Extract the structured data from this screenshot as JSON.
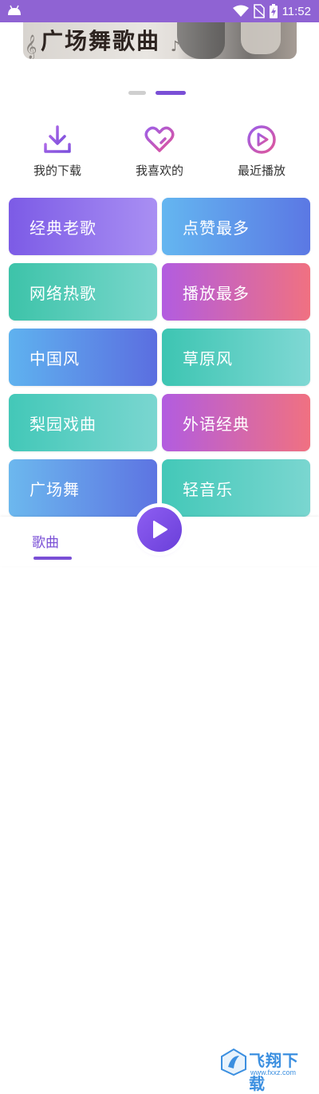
{
  "status_bar": {
    "time": "11:52"
  },
  "banner": {
    "title": "广场舞歌曲"
  },
  "pager": {
    "count": 2,
    "active_index": 1
  },
  "quick_actions": [
    {
      "label": "我的下载",
      "icon": "download-icon"
    },
    {
      "label": "我喜欢的",
      "icon": "heart-icon"
    },
    {
      "label": "最近播放",
      "icon": "play-circle-icon"
    }
  ],
  "categories": [
    {
      "label": "经典老歌"
    },
    {
      "label": "点赞最多"
    },
    {
      "label": "网络热歌"
    },
    {
      "label": "播放最多"
    },
    {
      "label": "中国风"
    },
    {
      "label": "草原风"
    },
    {
      "label": "梨园戏曲"
    },
    {
      "label": "外语经典"
    },
    {
      "label": "广场舞"
    },
    {
      "label": "轻音乐"
    }
  ],
  "bottom_nav": {
    "songs_label": "歌曲"
  },
  "watermark": {
    "text": "飞翔下载",
    "url": "www.fxxz.com"
  },
  "colors": {
    "accent": "#7a4fd6",
    "status_bar": "#8f63d3"
  }
}
